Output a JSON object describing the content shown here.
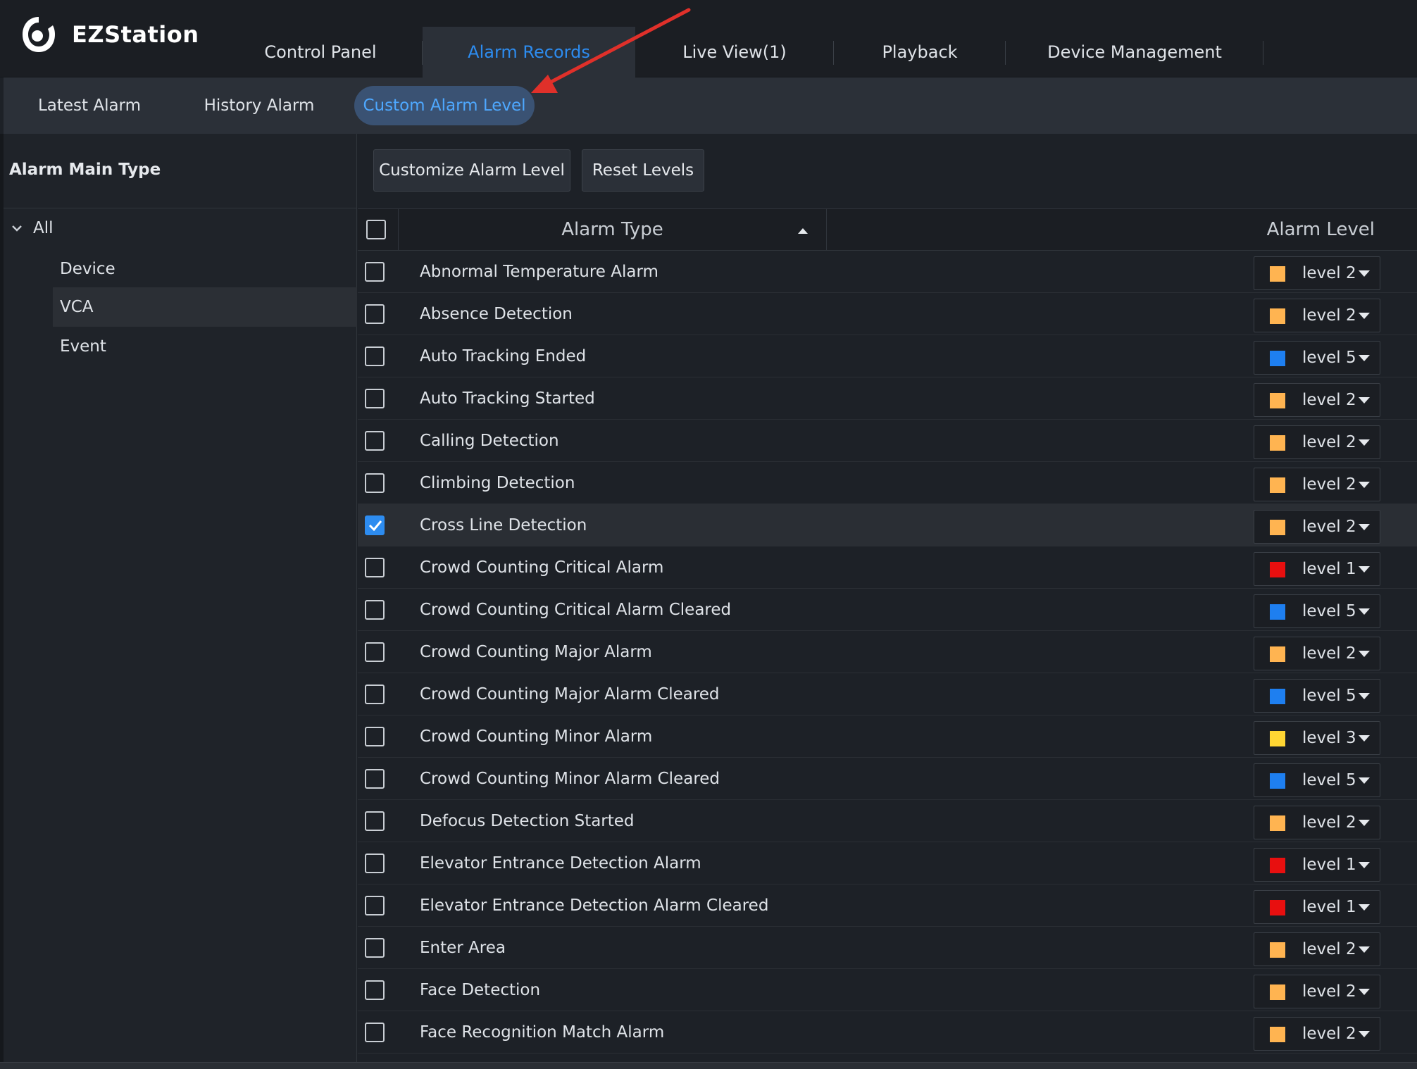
{
  "app": {
    "title": "EZStation"
  },
  "main_tabs": [
    {
      "label": "Control Panel"
    },
    {
      "label": "Alarm Records",
      "active": true
    },
    {
      "label": "Live View(1)"
    },
    {
      "label": "Playback"
    },
    {
      "label": "Device Management"
    }
  ],
  "sub_tabs": [
    {
      "label": "Latest Alarm"
    },
    {
      "label": "History Alarm"
    },
    {
      "label": "Custom Alarm Level",
      "active": true
    }
  ],
  "left": {
    "title": "Alarm Main Type",
    "tree": {
      "root": "All",
      "children": [
        "Device",
        "VCA",
        "Event"
      ],
      "selected": "VCA"
    }
  },
  "toolbar": {
    "customize_label": "Customize Alarm Level",
    "reset_label": "Reset Levels"
  },
  "table": {
    "col_type": "Alarm Type",
    "col_level": "Alarm Level",
    "rows": [
      {
        "type": "Abnormal Temperature Alarm",
        "level": "level 2",
        "checked": false
      },
      {
        "type": "Absence Detection",
        "level": "level 2",
        "checked": false
      },
      {
        "type": "Auto Tracking Ended",
        "level": "level 5",
        "checked": false
      },
      {
        "type": "Auto Tracking Started",
        "level": "level 2",
        "checked": false
      },
      {
        "type": "Calling Detection",
        "level": "level 2",
        "checked": false
      },
      {
        "type": "Climbing Detection",
        "level": "level 2",
        "checked": false
      },
      {
        "type": "Cross Line Detection",
        "level": "level 2",
        "checked": true
      },
      {
        "type": "Crowd Counting Critical Alarm",
        "level": "level 1",
        "checked": false
      },
      {
        "type": "Crowd Counting Critical Alarm Cleared",
        "level": "level 5",
        "checked": false
      },
      {
        "type": "Crowd Counting Major Alarm",
        "level": "level 2",
        "checked": false
      },
      {
        "type": "Crowd Counting Major Alarm Cleared",
        "level": "level 5",
        "checked": false
      },
      {
        "type": "Crowd Counting Minor Alarm",
        "level": "level 3",
        "checked": false
      },
      {
        "type": "Crowd Counting Minor Alarm Cleared",
        "level": "level 5",
        "checked": false
      },
      {
        "type": "Defocus Detection Started",
        "level": "level 2",
        "checked": false
      },
      {
        "type": "Elevator Entrance Detection Alarm",
        "level": "level 1",
        "checked": false
      },
      {
        "type": "Elevator Entrance Detection Alarm Cleared",
        "level": "level 1",
        "checked": false
      },
      {
        "type": "Enter Area",
        "level": "level 2",
        "checked": false
      },
      {
        "type": "Face Detection",
        "level": "level 2",
        "checked": false
      },
      {
        "type": "Face Recognition Match Alarm",
        "level": "level 2",
        "checked": false
      }
    ]
  },
  "level_colors": {
    "level 1": "#e80f0f",
    "level 2": "#ffb451",
    "level 3": "#ffd633",
    "level 5": "#1e7ff0"
  },
  "colors": {
    "accent": "#2d8cf0",
    "active_subtab_bg": "#3a5273",
    "annotation_arrow": "#e0302a"
  }
}
